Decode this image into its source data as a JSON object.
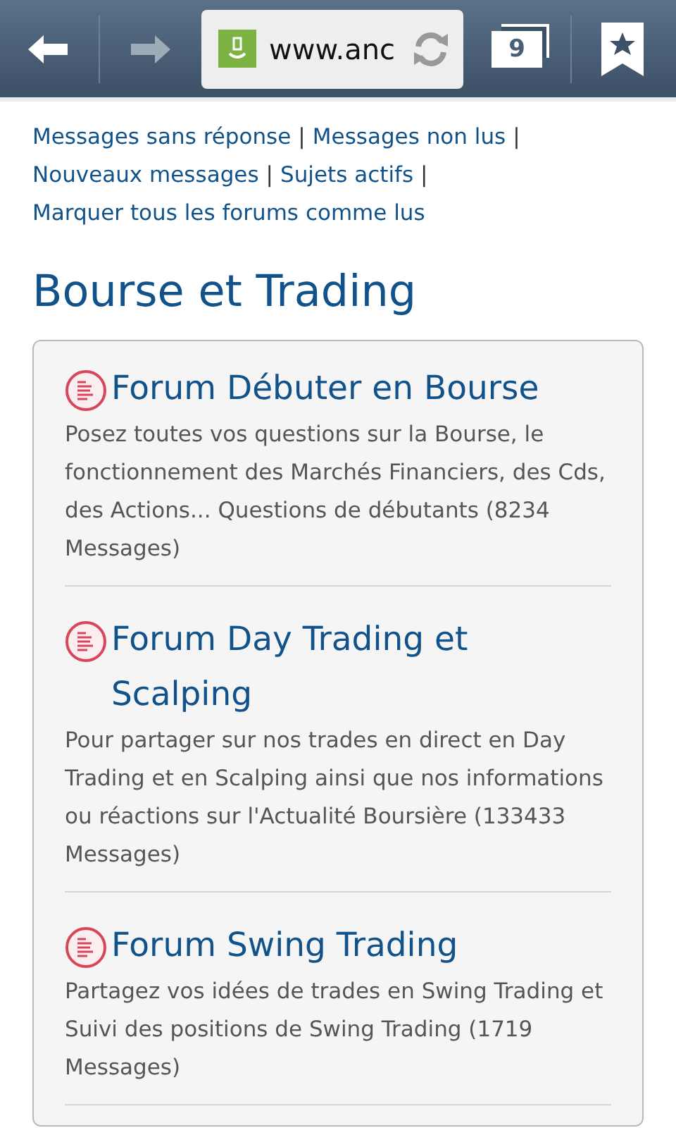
{
  "browser": {
    "url": "www.anc",
    "tab_count": "9",
    "back_enabled": true,
    "forward_enabled": false
  },
  "nav_links": [
    {
      "label": "Messages sans réponse",
      "separator": "|"
    },
    {
      "label": "Messages non lus",
      "separator": "|"
    },
    {
      "label": "Nouveaux messages",
      "separator": "|"
    },
    {
      "label": "Sujets actifs",
      "separator": "|"
    },
    {
      "label": "Marquer tous les forums comme lus"
    }
  ],
  "section_title": "Bourse et Trading",
  "forums": [
    {
      "title": "Forum Débuter en Bourse",
      "description": "Posez toutes vos questions sur la Bourse, le fonctionnement des Marchés Financiers, des Cds, des Actions... Questions de débutants (8234 Messages)"
    },
    {
      "title": "Forum Day Trading et Scalping",
      "description": "Pour partager sur nos trades en direct en Day Trading et en Scalping ainsi que nos informations ou réactions sur l'Actualité Boursière (133433 Messages)"
    },
    {
      "title": "Forum Swing Trading",
      "description": "Partagez vos idées de trades en Swing Trading et Suivi des positions de Swing Trading (1719 Messages)"
    }
  ]
}
